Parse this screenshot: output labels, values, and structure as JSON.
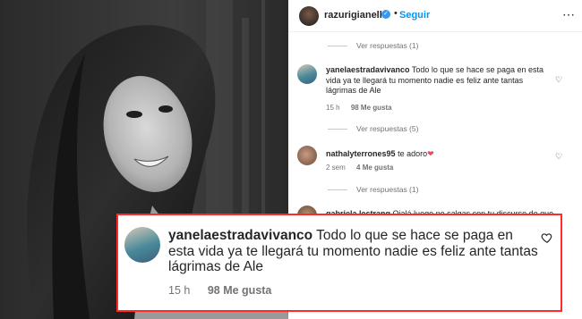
{
  "post": {
    "username": "razurigianella",
    "follow_label": "Seguir",
    "more_icon": "more-horizontal-icon",
    "dot": "•"
  },
  "comments": [
    {
      "type": "replies",
      "label": "Ver respuestas (1)"
    },
    {
      "type": "comment",
      "username": "yanelaestradavivanco",
      "text": "Todo lo que se hace se paga en esta vida ya te llegará tu momento nadie es feliz ante tantas lágrimas de Ale",
      "time": "15 h",
      "likes": "98 Me gusta"
    },
    {
      "type": "replies",
      "label": "Ver respuestas (5)"
    },
    {
      "type": "comment",
      "username": "nathalyterrones95",
      "text": "te adoro",
      "emoji": "❤",
      "time": "2 sem",
      "likes": "4 Me gusta"
    },
    {
      "type": "replies",
      "label": "Ver respuestas (1)"
    },
    {
      "type": "comment",
      "username": "gabriela.lestrang",
      "text": "Ojalá luego no salgas con tu discurso de que"
    }
  ],
  "highlight": {
    "username": "yanelaestradavivanco",
    "text": "Todo lo que se hace se paga en esta vida ya te llegará tu momento nadie es feliz ante tantas lágrimas de Ale",
    "time": "15 h",
    "likes": "98 Me gusta",
    "border_color": "#ff2a2a"
  },
  "colors": {
    "link_blue": "#0095f6",
    "muted": "#737373",
    "text": "#262626",
    "heart_red": "#ed4956"
  }
}
